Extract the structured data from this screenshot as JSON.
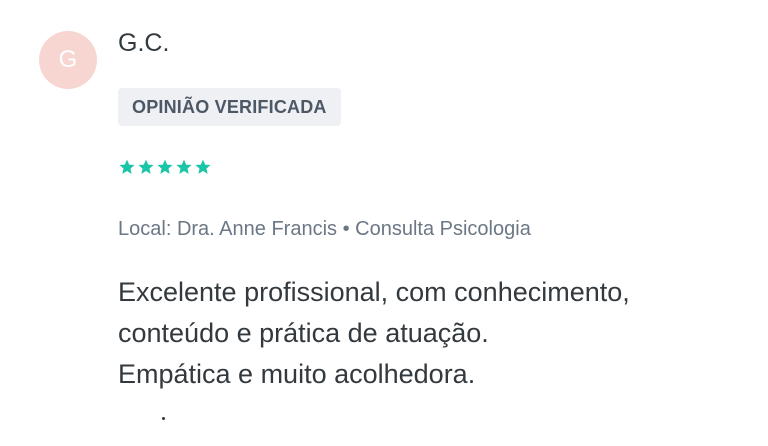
{
  "review": {
    "avatar_initial": "G",
    "author": "G.C.",
    "badge": "OPINIÃO VERIFICADA",
    "rating": 5,
    "rating_max": 5,
    "meta": {
      "label": "Local:",
      "doctor": "Dra. Anne Francis",
      "separator": "•",
      "service": "Consulta Psicologia"
    },
    "text_lines": [
      "Excelente profissional, com conhecimento,",
      "conteúdo e prática de atuação.",
      "Empática e muito acolhedora."
    ]
  },
  "colors": {
    "star": "#1bc5a8",
    "avatar_bg": "#f7d6d2",
    "badge_bg": "#eef0f3"
  },
  "icons": {
    "star": "star-icon"
  }
}
